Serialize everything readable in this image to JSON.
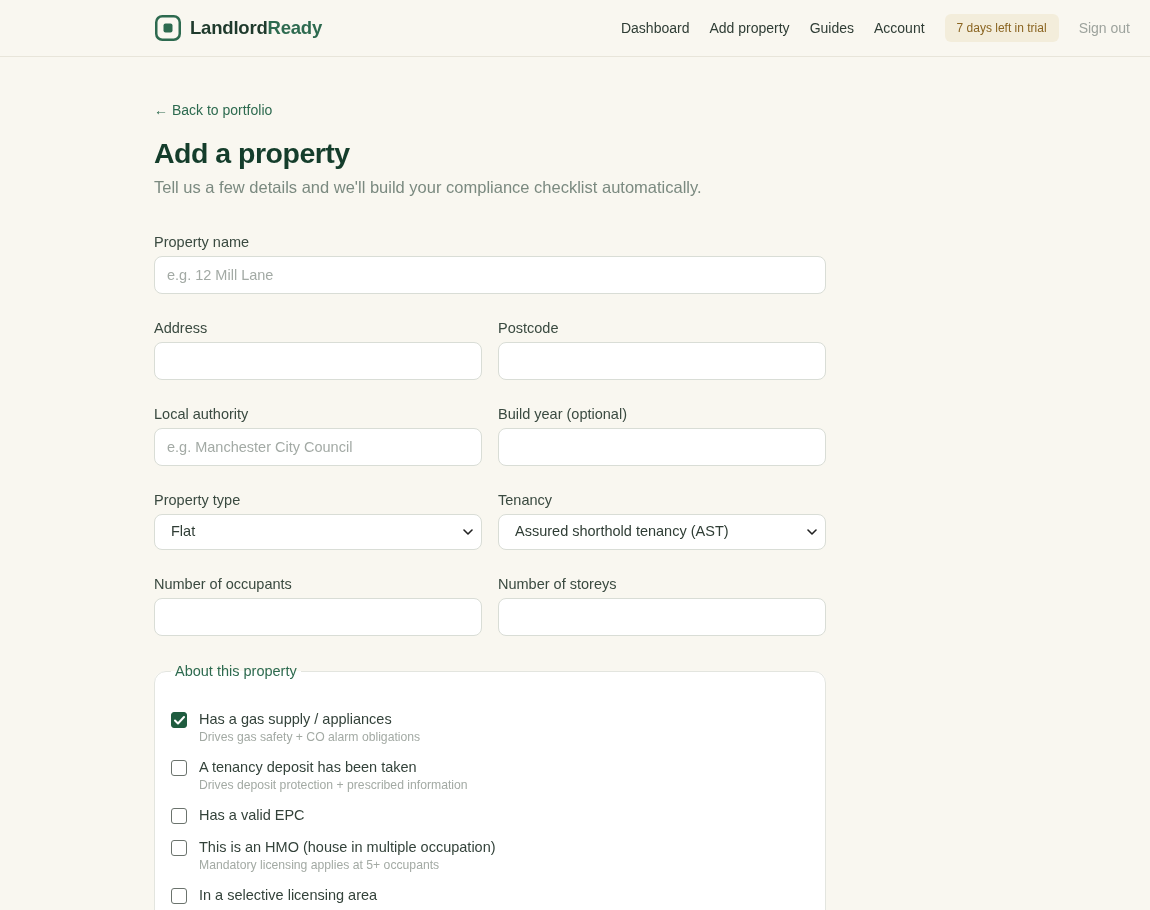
{
  "header": {
    "brand": {
      "name_start": "Landlord",
      "name_end": "Ready"
    },
    "nav_links": [
      "Dashboard",
      "Add property",
      "Guides",
      "Account"
    ],
    "trial_badge": "7 days left in trial",
    "sign_out": "Sign out"
  },
  "back_link": "← Back to portfolio",
  "title": "Add a property",
  "subtitle": "Tell us a few details and we'll build your compliance checklist automatically.",
  "form_rows": [
    [
      {
        "label": "Property name",
        "kind": "text",
        "placeholder": "e.g. 12 Mill Lane"
      }
    ],
    [
      {
        "label": "Address",
        "kind": "text"
      },
      {
        "label": "Postcode",
        "kind": "text"
      }
    ],
    [
      {
        "label": "Local authority",
        "kind": "text",
        "placeholder": "e.g. Manchester City Council"
      },
      {
        "label": "Build year (optional)",
        "kind": "text"
      }
    ],
    [
      {
        "label": "Property type",
        "kind": "select",
        "value": "Flat"
      },
      {
        "label": "Tenancy",
        "kind": "select",
        "value": "Assured shorthold tenancy (AST)"
      }
    ],
    [
      {
        "label": "Number of occupants",
        "kind": "text"
      },
      {
        "label": "Number of storeys",
        "kind": "text"
      }
    ]
  ],
  "about": {
    "legend": "About this property",
    "options": [
      {
        "label": "Has a gas supply / appliances",
        "hint": "Drives gas safety + CO alarm obligations",
        "checked": true
      },
      {
        "label": "A tenancy deposit has been taken",
        "hint": "Drives deposit protection + prescribed information",
        "checked": false
      },
      {
        "label": "Has a valid EPC",
        "checked": false
      },
      {
        "label": "This is an HMO (house in multiple occupation)",
        "hint": "Mandatory licensing applies at 5+ occupants",
        "checked": false
      },
      {
        "label": "In a selective licensing area",
        "checked": false
      }
    ]
  }
}
